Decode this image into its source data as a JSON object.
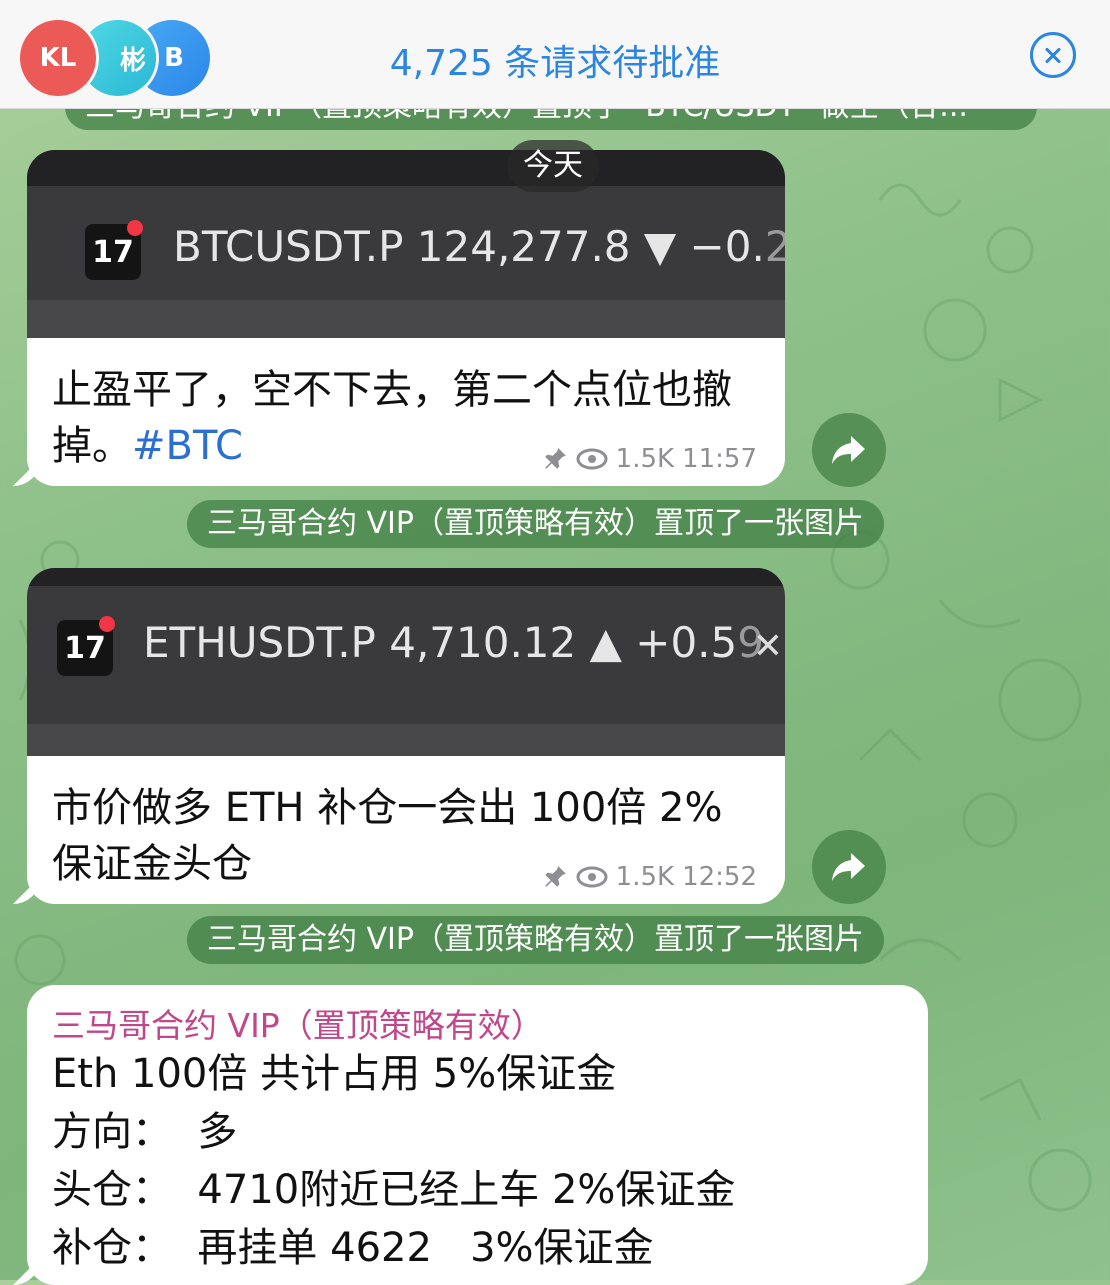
{
  "banner": {
    "avatars": [
      "KL",
      "彬",
      "B"
    ],
    "title": "4,725 条请求待批准"
  },
  "pinned_preview": "三马哥合约 VIP（置顶策略有效）置顶了 \"BTC/USDT\" 做空（合...",
  "day_label": "今天",
  "messages": [
    {
      "ticker": "BTCUSDT.P 124,277.8 ▼ −0.",
      "ticker_fade": "2",
      "text": "止盈平了，空不下去，第二个点位也撤掉。",
      "hashtag": "#BTC",
      "views": "1.5K",
      "time": "11:57"
    },
    {
      "ticker": "ETHUSDT.P 4,710.12 ▲ +0.5",
      "ticker_fade": "9",
      "text": "市价做多 ETH 补仓一会出 100倍 2%保证金头仓",
      "views": "1.5K",
      "time": "12:52"
    }
  ],
  "service_messages": [
    "三马哥合约 VIP（置顶策略有效）置顶了一张图片",
    "三马哥合约 VIP（置顶策略有效）置顶了一张图片"
  ],
  "last_message": {
    "sender": "三马哥合约 VIP（置顶策略有效）",
    "lines": [
      "Eth 100倍 共计占用 5%保证金",
      "方向：  多",
      "头仓：  4710附近已经上车 2%保证金",
      "补仓：  再挂单 4622   3%保证金"
    ]
  },
  "colors": {
    "accent": "#2b86e3",
    "sender": "#c0478a",
    "chat_bg": "#8ec08a"
  }
}
